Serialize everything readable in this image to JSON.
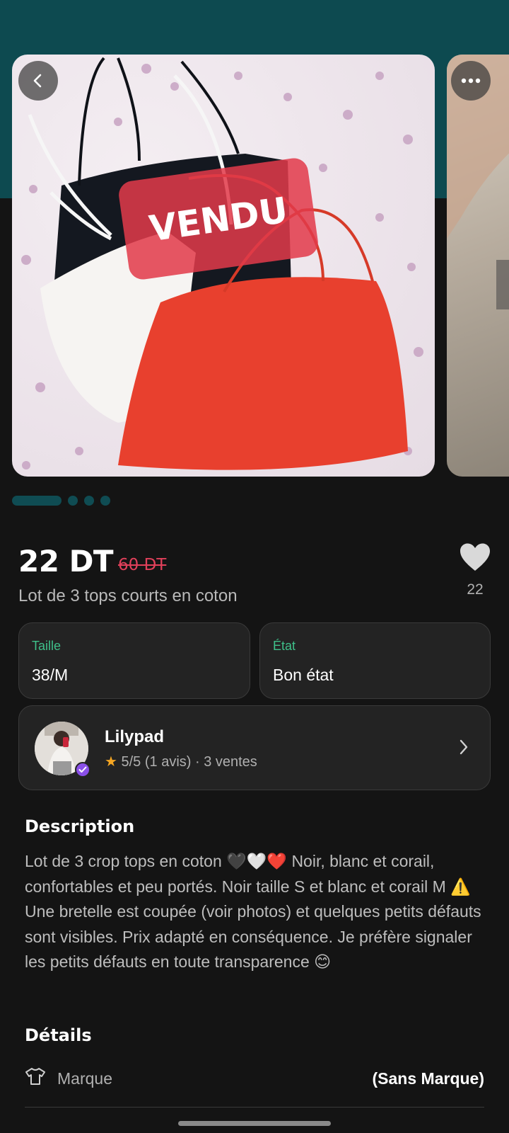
{
  "gallery": {
    "sold_badge": "VENDU",
    "dots_count": 4,
    "active_dot": 0
  },
  "listing": {
    "price": "22 DT",
    "original_price": "60 DT",
    "title": "Lot de 3 tops courts en coton",
    "likes": "22"
  },
  "attributes": {
    "size_label": "Taille",
    "size_value": "38/M",
    "condition_label": "État",
    "condition_value": "Bon état"
  },
  "seller": {
    "name": "Lilypad",
    "star": "★",
    "rating_text": "5/5 (1 avis) · 3 ventes"
  },
  "description": {
    "heading": "Description",
    "text": "Lot de 3 crop tops en coton 🖤🤍❤️ Noir, blanc et corail, confortables et peu portés. Noir taille S et blanc et corail M ⚠️ Une bretelle est coupée (voir photos) et quelques petits défauts sont visibles. Prix adapté en conséquence. Je préfère signaler les petits défauts en toute transparence 😊"
  },
  "details": {
    "heading": "Détails",
    "brand_label": "Marque",
    "brand_value": "(Sans Marque)"
  },
  "colors": {
    "teal": "#0d4a50",
    "sold_red": "#e23a4a",
    "accent_green": "#3fc08a",
    "verified_purple": "#8a4fe8",
    "star": "#f5a623"
  }
}
